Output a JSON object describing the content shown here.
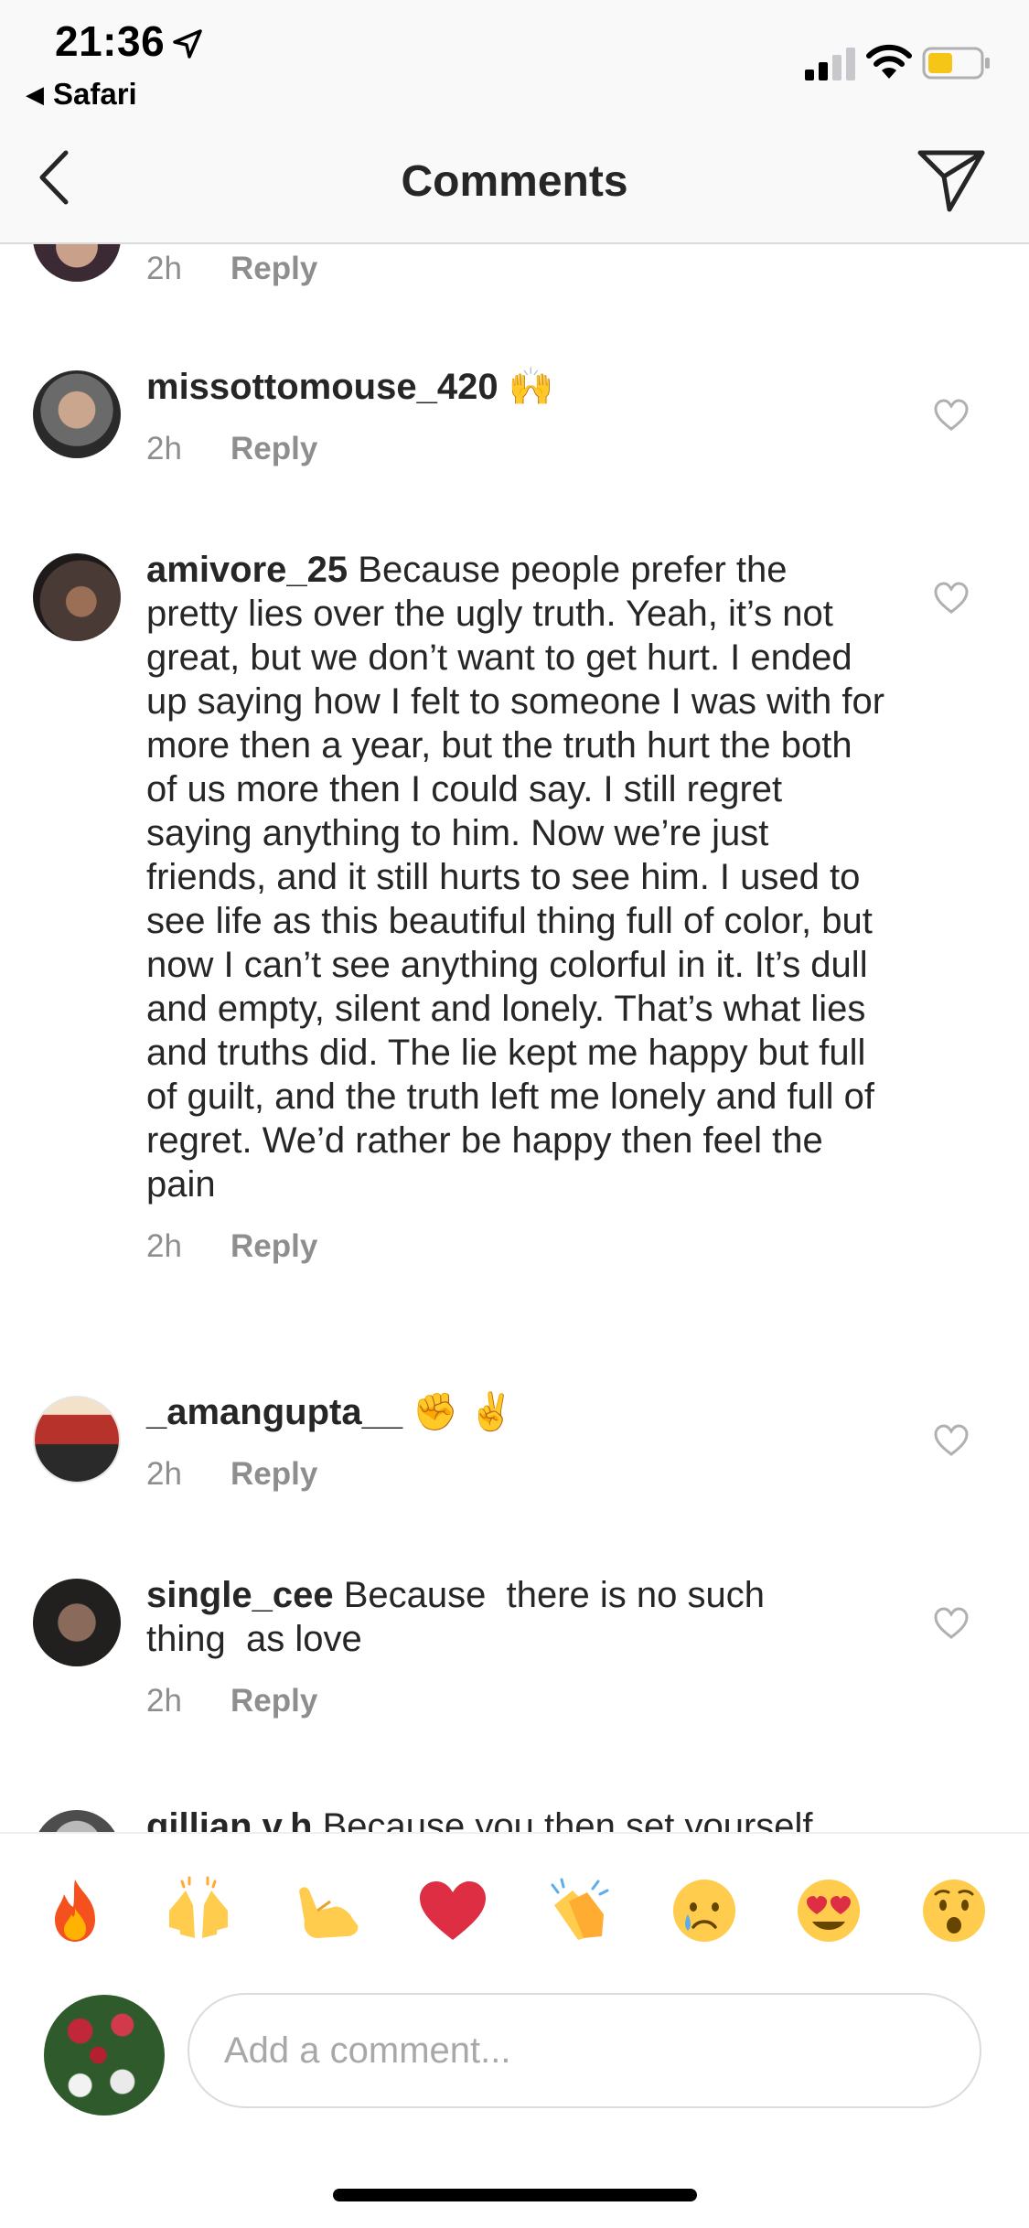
{
  "status_bar": {
    "time": "21:36",
    "back_app": "Safari"
  },
  "nav": {
    "title": "Comments"
  },
  "comments": [
    {
      "username": "",
      "text": "",
      "time": "2h",
      "reply": "Reply"
    },
    {
      "username": "missottomouse_420",
      "text": " 🙌",
      "time": "2h",
      "reply": "Reply"
    },
    {
      "username": "amivore_25",
      "text": " Because people prefer the pretty lies over the ugly truth. Yeah, it’s not great, but we don’t want to get hurt. I ended up saying how I felt to someone I was with for more then a year, but the truth hurt the both of us more then I could say. I still regret saying anything to him. Now we’re just friends, and it still hurts to see him. I used to see life as this beautiful thing full of color, but now I can’t see anything colorful in it. It’s dull and empty, silent and lonely. That’s what lies and truths did. The lie kept me happy but full of guilt, and the truth left me lonely and full of regret. We’d rather be happy then feel the pain",
      "time": "2h",
      "reply": "Reply"
    },
    {
      "username": "_amangupta__",
      "text": " ✊ ✌️",
      "time": "2h",
      "reply": "Reply"
    },
    {
      "username": "single_cee",
      "text": " Because  there is no such thing  as love",
      "time": "2h",
      "reply": "Reply"
    },
    {
      "username": "gillian.v.h",
      "text": " Because you then set yourself",
      "time": "",
      "reply": ""
    }
  ],
  "emoji_reactions": [
    "🔥",
    "🙌",
    "🤙",
    "❤️",
    "👏",
    "😢",
    "😍",
    "😮"
  ],
  "composer": {
    "placeholder": "Add a comment..."
  },
  "icons": {
    "back": "chevron-left-icon",
    "send": "paper-plane-icon",
    "like": "heart-outline-icon"
  },
  "colors": {
    "text": "#262626",
    "secondary": "#8e8e8e",
    "border": "#dbdbdb",
    "battery_low": "#f5c518"
  }
}
